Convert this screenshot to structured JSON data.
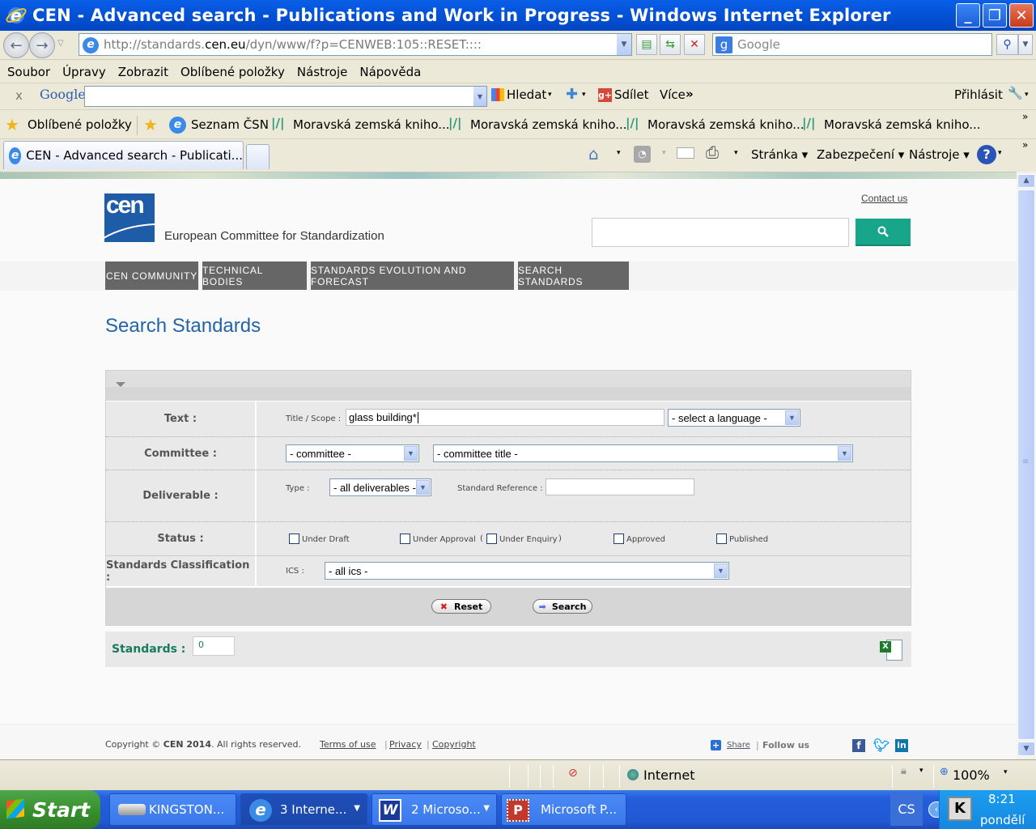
{
  "window": {
    "title": "CEN - Advanced search - Publications and Work in Progress - Windows Internet Explorer"
  },
  "addressbar": {
    "url_prefix": "http://standards.",
    "url_domain": "cen.eu",
    "url_suffix": "/dyn/www/f?p=CENWEB:105::RESET::::",
    "search_placeholder": "Google"
  },
  "menu": [
    "Soubor",
    "Úpravy",
    "Zobrazit",
    "Oblíbené položky",
    "Nástroje",
    "Nápověda"
  ],
  "google_toolbar": {
    "close": "x",
    "logo": "Google",
    "search_label": "Hledat",
    "share_label": "Sdílet",
    "more_label": "Více",
    "signin_label": "Přihlásit"
  },
  "favorites": {
    "label": "Oblíbené položky",
    "items": [
      "Seznam ČSN",
      "Moravská zemská kniho...",
      "Moravská zemská kniho...",
      "Moravská zemská kniho...",
      "Moravská zemská kniho..."
    ]
  },
  "tabs": {
    "active": "CEN - Advanced search - Publicati..."
  },
  "commandbar": {
    "page": "Stránka",
    "security": "Zabezpečení",
    "tools": "Nástroje"
  },
  "site": {
    "logo_text": "cen",
    "tagline": "European Committee for Standardization",
    "contact": "Contact us",
    "search_value": "",
    "nav": [
      "CEN COMMUNITY",
      "TECHNICAL BODIES",
      "STANDARDS EVOLUTION AND FORECAST",
      "SEARCH STANDARDS"
    ],
    "page_title": "Search Standards"
  },
  "form": {
    "text": {
      "label": "Text :",
      "field_label": "Title / Scope :",
      "value": "glass building*",
      "language": "- select a language -"
    },
    "committee": {
      "label": "Committee :",
      "committee": "- committee -",
      "committee_title": "- committee title -"
    },
    "deliverable": {
      "label": "Deliverable :",
      "type_label": "Type :",
      "type": "- all deliverables -",
      "ref_label": "Standard Reference :",
      "ref_value": ""
    },
    "status": {
      "label": "Status :",
      "options": [
        {
          "label": "Under Draft",
          "checked": false
        },
        {
          "label": "Under Approval",
          "checked": false
        },
        {
          "label": "Under Enquiry",
          "checked": false
        },
        {
          "label": "Approved",
          "checked": false
        },
        {
          "label": "Published",
          "checked": false
        }
      ],
      "paren_open": "(",
      "paren_close": ")"
    },
    "classification": {
      "label": "Standards Classification :",
      "ics_label": "ICS :",
      "ics": "- all ics -"
    },
    "reset": "Reset",
    "search": "Search"
  },
  "results": {
    "label": "Standards :",
    "count": "0"
  },
  "footer": {
    "copyright_pre": "Copyright © ",
    "copyright_bold": "CEN 2014",
    "copyright_post": ". All rights reserved.",
    "links": [
      "Terms of use",
      "Privacy",
      "Copyright"
    ],
    "share": "Share",
    "follow": "Follow us"
  },
  "statusbar": {
    "zone": "Internet",
    "zoom": "100%"
  },
  "taskbar": {
    "start": "Start",
    "tasks": [
      "KINGSTON...",
      "3 Interne...",
      "2 Microso...",
      "Microsoft P..."
    ],
    "lang": "CS",
    "time": "8:21",
    "day": "pondělí"
  },
  "colors": {
    "accent_teal": "#17a68a",
    "title_blue": "#2364a8",
    "nav_gray": "#666666",
    "results_green": "#1a7a5e"
  }
}
